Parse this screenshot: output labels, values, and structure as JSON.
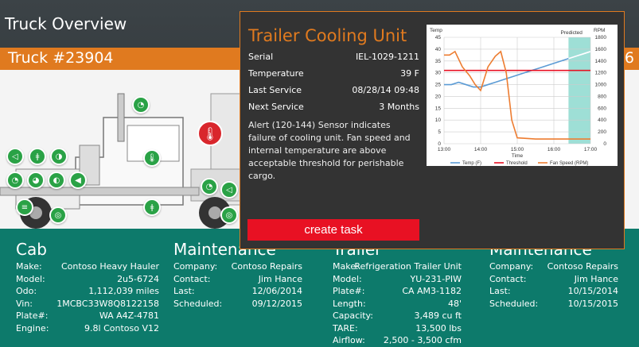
{
  "page_title": "Truck Overview",
  "truck": {
    "name": "Truck #23904",
    "tail": "6"
  },
  "colors": {
    "accent": "#e07a1f",
    "alert_red": "#e81123",
    "ok_green": "#2aa246",
    "panel": "#0d7a6b"
  },
  "diagram_icons": [
    "speedometer-icon",
    "thermometer-icon",
    "horn-icon",
    "gauge-icon",
    "thermometer-icon",
    "headlight-icon",
    "tire-icon",
    "fuel-icon",
    "headlight-icon",
    "engine-icon"
  ],
  "cab": {
    "title": "Cab",
    "rows": [
      {
        "label": "Make:",
        "value": "Contoso Heavy Hauler"
      },
      {
        "label": "Model:",
        "value": "2u5-6724"
      },
      {
        "label": "Odo:",
        "value": "1,112,039 miles"
      },
      {
        "label": "Vin:",
        "value": "1MCBC33W8Q8122158"
      },
      {
        "label": "Plate#:",
        "value": "WA A4Z-4781"
      },
      {
        "label": "Engine:",
        "value": "9.8l Contoso V12"
      }
    ]
  },
  "cab_maint": {
    "title": "Maintenance",
    "rows": [
      {
        "label": "Company:",
        "value": "Contoso Repairs"
      },
      {
        "label": "Contact:",
        "value": "Jim Hance"
      },
      {
        "label": "Last:",
        "value": "12/06/2014"
      },
      {
        "label": "Scheduled:",
        "value": "09/12/2015"
      }
    ]
  },
  "trailer": {
    "title": "Trailer",
    "rows": [
      {
        "label": "Make:",
        "value": "Refrigeration Trailer Unit"
      },
      {
        "label": "Model:",
        "value": "YU-231-PIW"
      },
      {
        "label": "Plate#:",
        "value": "CA AM3-1182"
      },
      {
        "label": "Length:",
        "value": "48'"
      },
      {
        "label": "Capacity:",
        "value": "3,489 cu ft"
      },
      {
        "label": "TARE:",
        "value": "13,500 lbs"
      },
      {
        "label": "Airflow:",
        "value": "2,500 - 3,500 cfm"
      }
    ]
  },
  "trailer_maint": {
    "title": "Maintenance",
    "rows": [
      {
        "label": "Company:",
        "value": "Contoso Repairs"
      },
      {
        "label": "Contact:",
        "value": "Jim Hance"
      },
      {
        "label": "Last:",
        "value": "10/15/2014"
      },
      {
        "label": "Scheduled:",
        "value": "10/15/2015"
      }
    ]
  },
  "popup": {
    "title": "Trailer Cooling Unit",
    "rows": [
      {
        "label": "Serial",
        "value": "IEL-1029-1211"
      },
      {
        "label": "Temperature",
        "value": "39 F"
      },
      {
        "label": "Last Service",
        "value": "08/28/14 09:48"
      },
      {
        "label": "Next Service",
        "value": "3 Months"
      }
    ],
    "alert": "Alert (120-144) Sensor indicates failure of cooling unit. Fan speed and internal temperature are above acceptable threshold for perishable cargo.",
    "button": "create task"
  },
  "chart_data": {
    "type": "line",
    "ylabel_left": "Temp",
    "ylabel_right": "RPM",
    "xlabel": "Time",
    "predicted_label": "Predicted",
    "x_ticks": [
      "13:00",
      "14:00",
      "15:00",
      "16:00",
      "17:00"
    ],
    "y_left_ticks": [
      0,
      5,
      10,
      15,
      20,
      25,
      30,
      35,
      40,
      45
    ],
    "y_right_ticks": [
      0,
      200,
      400,
      600,
      800,
      1000,
      1200,
      1400,
      1600,
      1800
    ],
    "ylim_left": [
      0,
      45
    ],
    "ylim_right": [
      0,
      1800
    ],
    "xlim": [
      13,
      17
    ],
    "predicted_range": [
      16.4,
      17
    ],
    "series": [
      {
        "name": "Temp (F)",
        "color": "#5b9bd5",
        "axis": "left",
        "x": [
          13,
          13.2,
          13.4,
          13.6,
          13.8,
          14.0,
          14.2,
          14.4,
          14.6,
          14.8,
          15.0,
          15.2,
          15.4,
          15.6,
          15.8,
          16.0,
          16.2,
          16.4,
          16.6,
          16.8,
          17.0
        ],
        "y": [
          25,
          25,
          26,
          25,
          24,
          24,
          25,
          26,
          27,
          28,
          29,
          30,
          31,
          32,
          33,
          34,
          35,
          36,
          37,
          38,
          39
        ]
      },
      {
        "name": "Threshold",
        "color": "#e81123",
        "axis": "left",
        "x": [
          13,
          17
        ],
        "y": [
          31,
          31
        ]
      },
      {
        "name": "Fan Speed (RPM)",
        "color": "#ed7d31",
        "axis": "right",
        "x": [
          13,
          13.15,
          13.3,
          13.5,
          13.7,
          13.85,
          14.0,
          14.2,
          14.4,
          14.55,
          14.7,
          14.85,
          15.0,
          15.5,
          16.0,
          16.4,
          16.6,
          17.0
        ],
        "y": [
          1500,
          1500,
          1560,
          1300,
          1150,
          1000,
          900,
          1300,
          1480,
          1560,
          1200,
          400,
          100,
          80,
          80,
          80,
          80,
          80
        ]
      }
    ]
  }
}
